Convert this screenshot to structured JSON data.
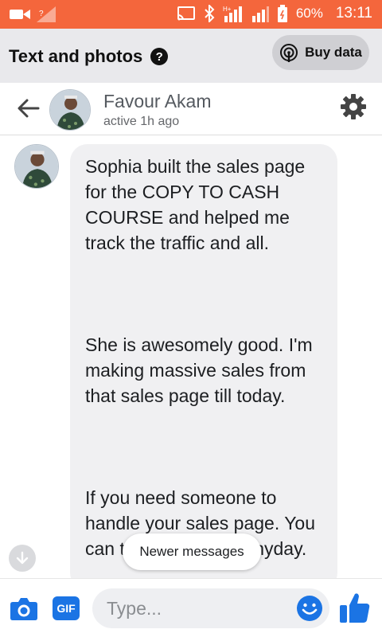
{
  "statusbar": {
    "battery": "60%",
    "time": "13:11",
    "network_label": "H+"
  },
  "header": {
    "title": "Text and photos",
    "buy_data_label": "Buy data"
  },
  "chat": {
    "contact_name": "Favour Akam",
    "contact_status": "active 1h ago"
  },
  "message": {
    "paragraphs": [
      "Sophia built the sales page for the COPY TO CASH COURSE and helped me track the traffic and all.",
      "She is awesomely good. I'm making massive sales from that sales page till today.",
      "If you need someone to handle your sales page. You can trust her with it anyday."
    ]
  },
  "newer_messages_label": "Newer messages",
  "composer": {
    "placeholder": "Type...",
    "gif_label": "GIF"
  },
  "colors": {
    "accent": "#1b74e4",
    "statusbar": "#f4663c"
  },
  "icons": [
    "video-icon",
    "signal-icon",
    "cast-icon",
    "bluetooth-icon",
    "battery-icon",
    "help-icon",
    "broadcast-icon",
    "back-arrow-icon",
    "gear-icon",
    "down-arrow-icon",
    "camera-icon",
    "emoji-icon",
    "thumbs-up-icon"
  ]
}
